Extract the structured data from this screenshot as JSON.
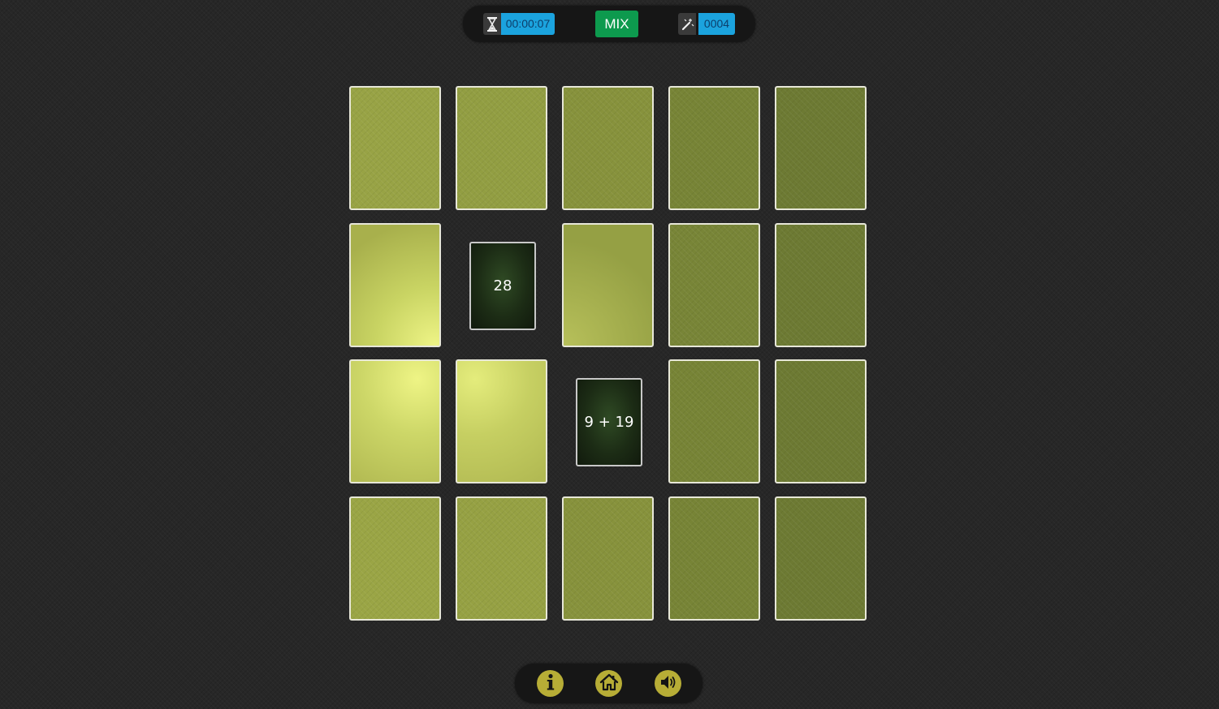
{
  "hud": {
    "timer": "00:00:07",
    "mix_label": "MIX",
    "moves": "0004",
    "icons": {
      "timer": "hourglass-icon",
      "moves": "magic-wand-icon"
    },
    "colors": {
      "value_bg": "#1ba3de",
      "mix_bg": "#0d9a4e"
    }
  },
  "board": {
    "rows": 4,
    "columns": 5,
    "face_up_cards": [
      {
        "row": 2,
        "col": 2,
        "text": "28"
      },
      {
        "row": 3,
        "col": 3,
        "text": "9 + 19"
      }
    ],
    "colors": {
      "card_back": "#9aa545",
      "card_back_highlight": "#e6f07a",
      "card_face": "#1c2c15"
    }
  },
  "footer": {
    "buttons": [
      {
        "name": "info-button",
        "icon": "info-icon"
      },
      {
        "name": "home-button",
        "icon": "home-icon"
      },
      {
        "name": "sound-button",
        "icon": "speaker-icon"
      }
    ],
    "colors": {
      "button_bg": "#b7ad36",
      "icon": "#141414"
    }
  }
}
